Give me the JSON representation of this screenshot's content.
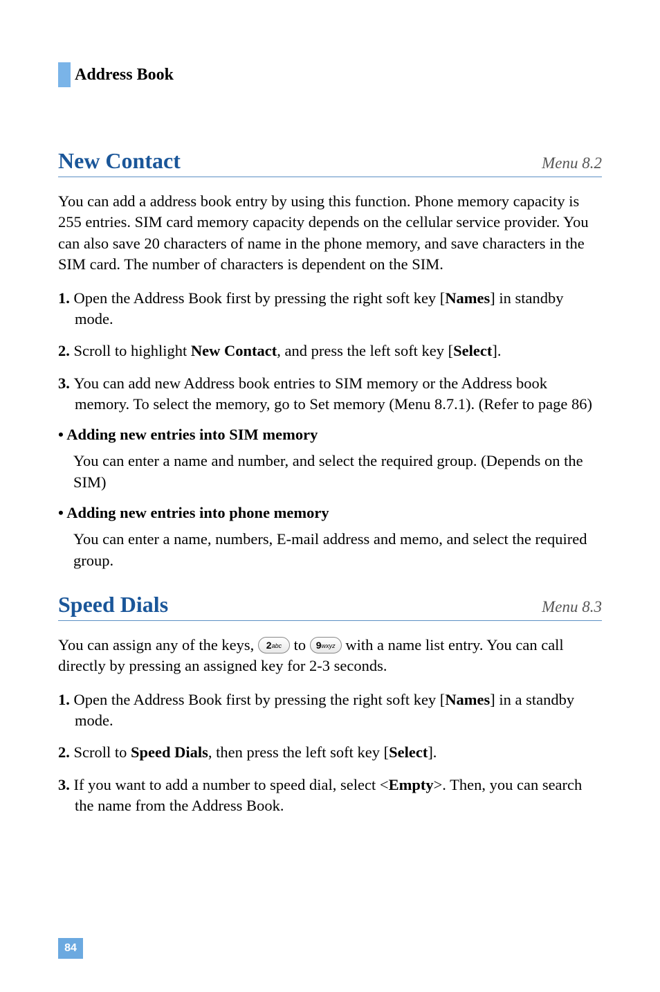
{
  "chapter": {
    "title": "Address Book"
  },
  "section1": {
    "title": "New Contact",
    "menu": "Menu 8.2",
    "intro": "You can add a address book entry by using this function. Phone memory capacity is 255 entries. SIM card memory capacity depends on the cellular service provider. You can also save 20 characters of name in the phone memory, and save characters in the SIM card. The number of characters is dependent on the SIM.",
    "step1_a": "Open the Address Book first by pressing the right soft key [",
    "step1_b": "Names",
    "step1_c": "] in standby mode.",
    "step2_a": "Scroll to highlight ",
    "step2_b": "New Contact",
    "step2_c": ", and press the left soft key [",
    "step2_d": "Select",
    "step2_e": "].",
    "step3": "You can add new Address book entries to SIM memory or the Address book memory. To select the memory, go to Set memory (Menu 8.7.1). (Refer to page 86)",
    "bullet1_heading": "• Adding new entries into SIM memory",
    "bullet1_body": "You can enter a name and number, and select the required group. (Depends on the SIM)",
    "bullet2_heading": "• Adding new entries into phone memory",
    "bullet2_body": "You can enter a name, numbers, E-mail address and memo, and select the required group."
  },
  "section2": {
    "title": "Speed Dials",
    "menu": "Menu 8.3",
    "intro_a": "You can assign any of the keys, ",
    "intro_b": " to ",
    "intro_c": " with a name list entry. You can call directly by pressing an assigned key for 2-3 seconds.",
    "key2_num": "2",
    "key2_sub": "abc",
    "key9_num": "9",
    "key9_sub": "wxyz",
    "step1_a": "Open the Address Book first by pressing the right soft key [",
    "step1_b": "Names",
    "step1_c": "] in a standby mode.",
    "step2_a": "Scroll to ",
    "step2_b": "Speed Dials",
    "step2_c": ", then press the left soft key [",
    "step2_d": "Select",
    "step2_e": "].",
    "step3_a": "If you want to add a number to speed dial, select <",
    "step3_b": "Empty",
    "step3_c": ">. Then, you can search the name from the Address Book."
  },
  "pageNumber": "84"
}
